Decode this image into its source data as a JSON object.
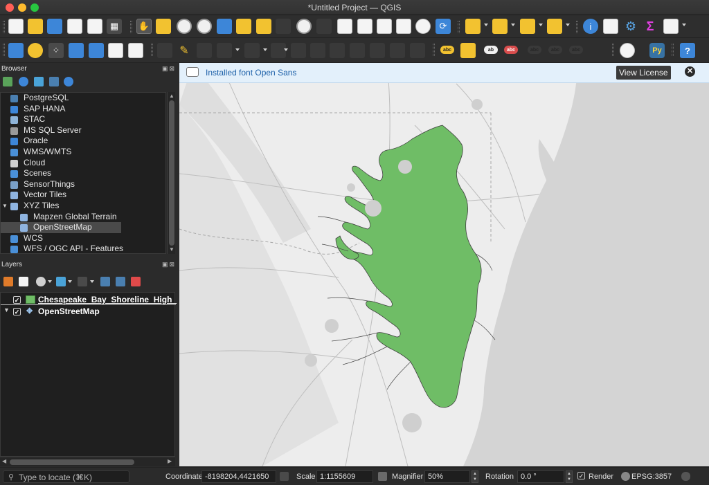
{
  "window": {
    "title": "*Untitled Project — QGIS"
  },
  "toolbar1": {
    "items": [
      "new-project",
      "open-project",
      "save-project",
      "save-as",
      "print-layout",
      "style-manager",
      "pan",
      "pan-to-selection",
      "zoom-in",
      "zoom-out",
      "zoom-full",
      "zoom-to-selection",
      "zoom-to-layer",
      "zoom-native",
      "zoom-last",
      "zoom-next",
      "new-bookmark",
      "show-bookmarks",
      "map-tips",
      "new-3d-view",
      "temporal-controller",
      "refresh",
      "select-features",
      "select-by-value",
      "deselect",
      "select-by-location",
      "identify",
      "attribute-table",
      "toolbox",
      "statistics",
      "open-field-calculator"
    ]
  },
  "toolbar2": {
    "items": [
      "data-source-manager",
      "new-geopackage-layer",
      "new-temporary-layer",
      "digitize",
      "add-polygon",
      "vertex-tool",
      "label-tool"
    ]
  },
  "browser": {
    "title": "Browser",
    "items": [
      {
        "label": "PostgreSQL",
        "icon": "elephant-icon",
        "indent": 0
      },
      {
        "label": "SAP HANA",
        "icon": "database-icon",
        "indent": 0
      },
      {
        "label": "STAC",
        "icon": "stac-icon",
        "indent": 0
      },
      {
        "label": "MS SQL Server",
        "icon": "mssql-icon",
        "indent": 0
      },
      {
        "label": "Oracle",
        "icon": "oracle-icon",
        "indent": 0
      },
      {
        "label": "WMS/WMTS",
        "icon": "globe-icon",
        "indent": 0
      },
      {
        "label": "Cloud",
        "icon": "cloud-icon",
        "indent": 0
      },
      {
        "label": "Scenes",
        "icon": "cube-icon",
        "indent": 0
      },
      {
        "label": "SensorThings",
        "icon": "sensor-icon",
        "indent": 0
      },
      {
        "label": "Vector Tiles",
        "icon": "grid-icon",
        "indent": 0
      },
      {
        "label": "XYZ Tiles",
        "icon": "grid-icon",
        "indent": 0,
        "expanded": true
      },
      {
        "label": "Mapzen Global Terrain",
        "icon": "grid-icon",
        "indent": 1
      },
      {
        "label": "OpenStreetMap",
        "icon": "grid-icon",
        "indent": 1,
        "selected": true
      },
      {
        "label": "WCS",
        "icon": "globe-icon",
        "indent": 0
      },
      {
        "label": "WFS / OGC API - Features",
        "icon": "globe-icon",
        "indent": 0
      }
    ]
  },
  "layers": {
    "title": "Layers",
    "rows": [
      {
        "name": "Chesapeake_Bay_Shoreline_High_",
        "checked": true,
        "swatch": "#6fbd66"
      },
      {
        "name": "OpenStreetMap",
        "checked": true,
        "swatch": ""
      }
    ]
  },
  "message": {
    "text": "Installed font Open Sans",
    "button": "View License"
  },
  "status": {
    "locate_placeholder": "Type to locate (⌘K)",
    "coordinate_label": "Coordinate",
    "coordinate_value": "-8198204,4421650",
    "scale_label": "Scale",
    "scale_value": "1:1155609",
    "magnifier_label": "Magnifier",
    "magnifier_value": "50%",
    "rotation_label": "Rotation",
    "rotation_value": "0.0 °",
    "render_label": "Render",
    "crs": "EPSG:3857"
  },
  "colors": {
    "bay": "#6fbd66",
    "map_land": "#ededed",
    "map_water": "#d4d4d4",
    "accent": "#1b5fa8"
  }
}
